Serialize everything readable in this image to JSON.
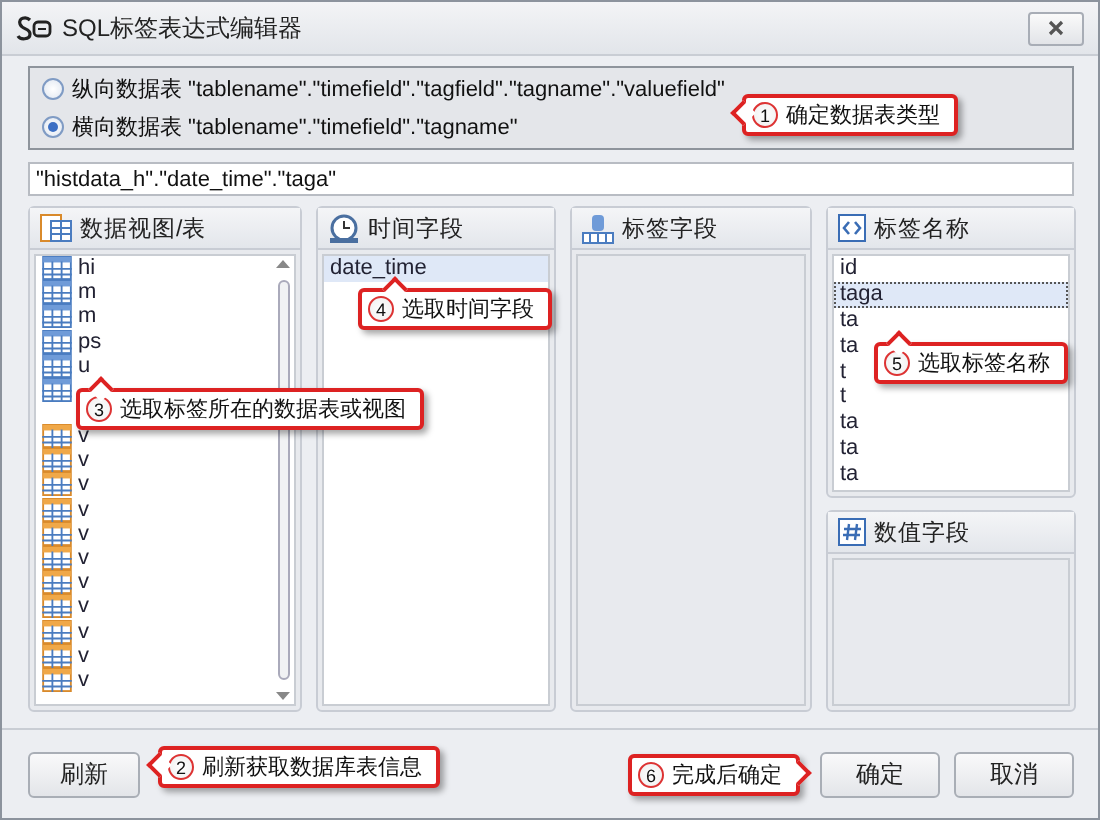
{
  "window": {
    "title": "SQL标签表达式编辑器"
  },
  "table_type": {
    "options": [
      {
        "label": "纵向数据表 \"tablename\".\"timefield\".\"tagfield\".\"tagname\".\"valuefield\"",
        "selected": false
      },
      {
        "label": "横向数据表 \"tablename\".\"timefield\".\"tagname\"",
        "selected": true
      }
    ]
  },
  "expression": {
    "value": "\"histdata_h\".\"date_time\".\"taga\""
  },
  "panels": [
    {
      "kind": "tables",
      "title": "数据视图/表",
      "items": [
        {
          "kind": "table",
          "label": "hi"
        },
        {
          "kind": "table",
          "label": "m"
        },
        {
          "kind": "table",
          "label": "m"
        },
        {
          "kind": "table",
          "label": "ps"
        },
        {
          "kind": "table",
          "label": "u"
        },
        {
          "kind": "table"
        },
        {
          "kind": "view",
          "label": "v"
        },
        {
          "kind": "view",
          "label": "v"
        },
        {
          "kind": "view",
          "label": "v"
        },
        {
          "kind": "view",
          "label": "v"
        },
        {
          "kind": "view",
          "label": "v"
        },
        {
          "kind": "view",
          "label": "v"
        },
        {
          "kind": "view",
          "label": "v"
        },
        {
          "kind": "view",
          "label": "v"
        },
        {
          "kind": "view",
          "label": "v"
        },
        {
          "kind": "view",
          "label": "v"
        },
        {
          "kind": "view",
          "label": "v"
        }
      ]
    },
    {
      "kind": "time",
      "title": "时间字段",
      "items": [
        {
          "label": "date_time",
          "selected": true
        }
      ]
    },
    {
      "kind": "tag",
      "title": "标签字段"
    },
    {
      "kind": "names",
      "title": "标签名称",
      "items": [
        {
          "label": "id",
          "selected": false
        },
        {
          "label": "taga",
          "selected": true
        },
        {
          "label": "ta",
          "selected": false
        },
        {
          "label": "ta",
          "selected": false
        },
        {
          "label": "t",
          "selected": false
        },
        {
          "label": "t",
          "selected": false
        },
        {
          "label": "ta",
          "selected": false
        },
        {
          "label": "ta",
          "selected": false
        },
        {
          "label": "ta",
          "selected": false
        }
      ]
    },
    {
      "kind": "value",
      "title": "数值字段"
    }
  ],
  "buttons": {
    "refresh": "刷新",
    "ok": "确定",
    "cancel": "取消"
  },
  "callouts": [
    {
      "number": "1",
      "text": "确定数据表类型"
    },
    {
      "number": "4",
      "text": "选取时间字段"
    },
    {
      "number": "5",
      "text": "选取标签名称"
    },
    {
      "number": "3",
      "text": "选取标签所在的数据表或视图"
    },
    {
      "number": "2",
      "text": "刷新获取数据库表信息"
    },
    {
      "number": "6",
      "text": "完成后确定"
    }
  ]
}
